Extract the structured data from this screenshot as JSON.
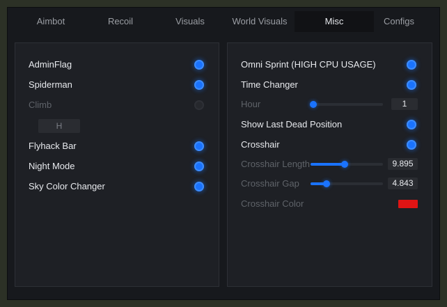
{
  "tabs": [
    {
      "label": "Aimbot"
    },
    {
      "label": "Recoil"
    },
    {
      "label": "Visuals"
    },
    {
      "label": "World Visuals"
    },
    {
      "label": "Misc"
    },
    {
      "label": "Configs"
    }
  ],
  "left": {
    "adminflag": {
      "label": "AdminFlag",
      "enabled": true
    },
    "spiderman": {
      "label": "Spiderman",
      "enabled": true
    },
    "climb": {
      "label": "Climb",
      "enabled": false,
      "keybind": "H"
    },
    "flyhack_bar": {
      "label": "Flyhack Bar",
      "enabled": true
    },
    "night_mode": {
      "label": "Night Mode",
      "enabled": true
    },
    "sky_color_changer": {
      "label": "Sky Color Changer",
      "enabled": true
    }
  },
  "right": {
    "omni_sprint": {
      "label": "Omni Sprint (HIGH CPU USAGE)",
      "enabled": true
    },
    "time_changer": {
      "label": "Time Changer",
      "enabled": true
    },
    "hour": {
      "label": "Hour",
      "value": "1",
      "fraction": 0.04
    },
    "show_last_dead": {
      "label": "Show Last Dead Position",
      "enabled": true
    },
    "crosshair": {
      "label": "Crosshair",
      "enabled": true
    },
    "crosshair_length": {
      "label": "Crosshair Length",
      "value": "9.895",
      "fraction": 0.47
    },
    "crosshair_gap": {
      "label": "Crosshair Gap",
      "value": "4.843",
      "fraction": 0.22
    },
    "crosshair_color": {
      "label": "Crosshair Color",
      "color": "#e01414"
    }
  },
  "colors": {
    "accent": "#1a73ff",
    "background": "#17191d",
    "panel": "#1e2025"
  }
}
